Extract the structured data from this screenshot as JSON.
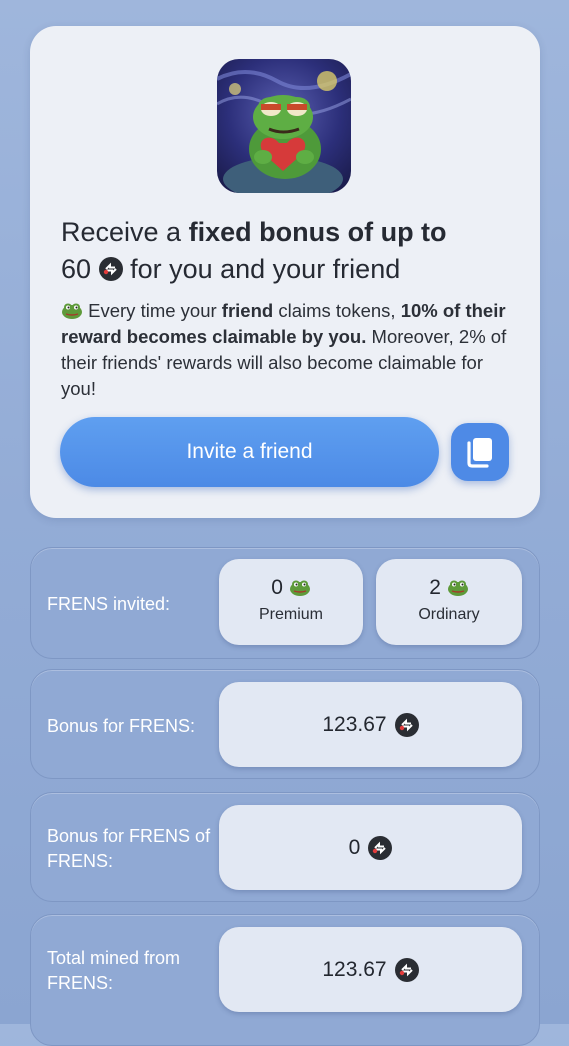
{
  "promo": {
    "headline_pre": "Receive a ",
    "headline_bold": "fixed bonus of up to",
    "headline_amount": "60",
    "headline_post": " for you and your friend",
    "desc_a": " Every time your ",
    "desc_friend": "friend",
    "desc_b": " claims tokens, ",
    "desc_bold": "10% of their reward becomes claimable by you.",
    "desc_c": " Moreover, 2% of their friends' rewards will also become claimable for you!",
    "invite_label": "Invite a friend"
  },
  "stats": {
    "invited_label": "FRENS invited:",
    "premium_count": "0",
    "premium_label": "Premium",
    "ordinary_count": "2",
    "ordinary_label": "Ordinary",
    "bonus_label": "Bonus for FRENS:",
    "bonus_value": "123.67",
    "fof_label": "Bonus for FRENS of FRENS:",
    "fof_value": "0",
    "total_label": "Total mined from FRENS:",
    "total_value": "123.67"
  },
  "colors": {
    "accent": "#4e8ae6",
    "card_bg": "#edf0f6",
    "panel_bg": "#90a9d4",
    "chip_bg": "#e2e8f3"
  },
  "icons": {
    "avatar": "frog-holding-heart-avatar",
    "coin": "token-coin-icon",
    "frog": "frog-emoji-icon",
    "copy": "copy-icon"
  }
}
